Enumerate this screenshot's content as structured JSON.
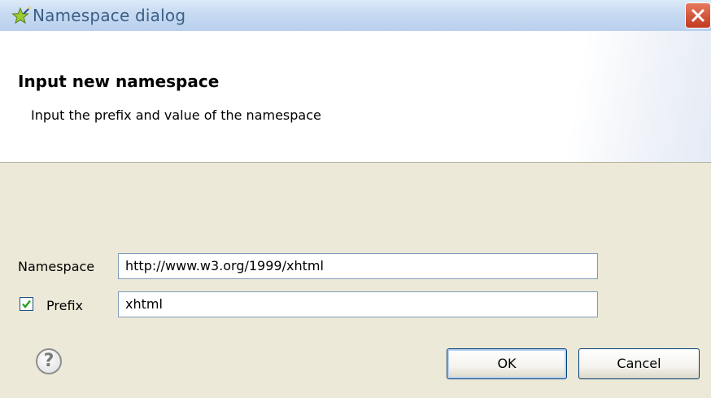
{
  "window": {
    "title": "Namespace dialog",
    "title_icon": "wizard-star-icon",
    "close_icon": "close-icon"
  },
  "banner": {
    "title": "Input new namespace",
    "description": "Input the prefix and value of the namespace"
  },
  "form": {
    "namespace_label": "Namespace",
    "namespace_value": "http://www.w3.org/1999/xhtml",
    "prefix_label": "Prefix",
    "prefix_checked": true,
    "prefix_value": "xhtml"
  },
  "footer": {
    "help_glyph": "?",
    "ok_label": "OK",
    "cancel_label": "Cancel"
  },
  "colors": {
    "dialog_bg": "#ece9d8",
    "title_text": "#3b5f86",
    "close_red": "#c3391f",
    "check_green": "#21a121"
  }
}
